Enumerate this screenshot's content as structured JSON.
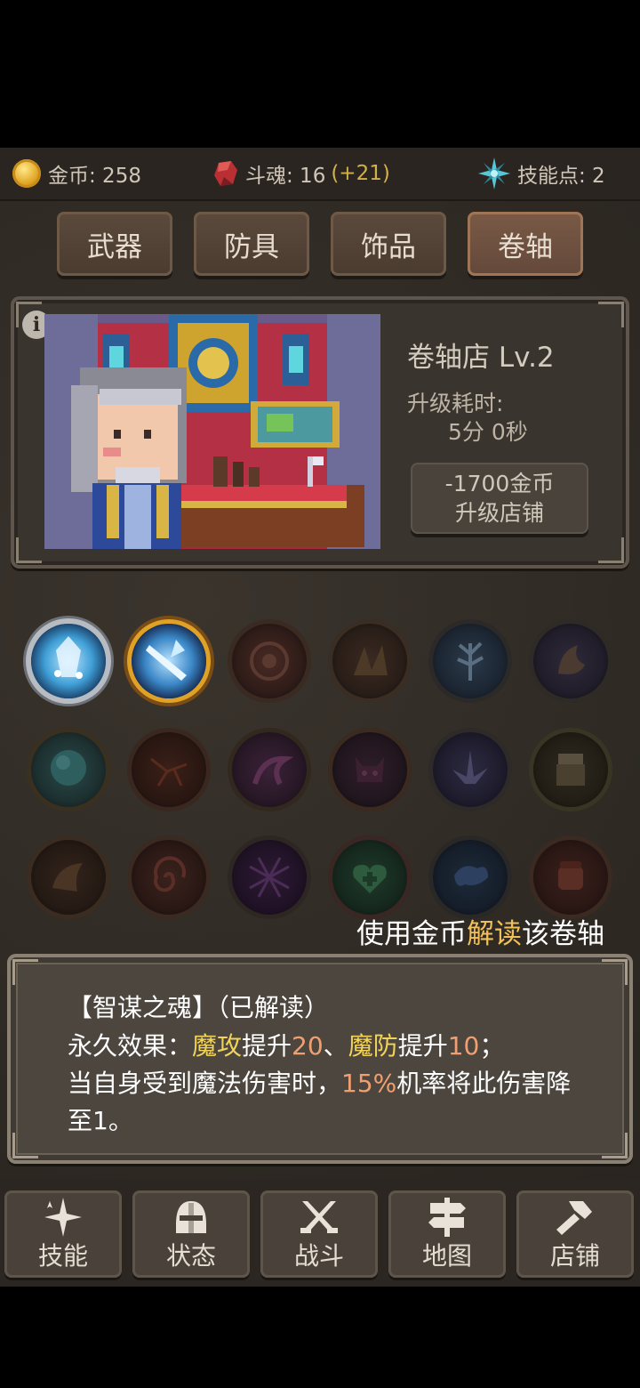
{
  "resources": {
    "gold_label": "金币: 258",
    "soul_label": "斗魂: 16",
    "soul_bonus": "(+21)",
    "skillpoint_label": "技能点: 2"
  },
  "tabs": [
    {
      "label": "武器",
      "active": false
    },
    {
      "label": "防具",
      "active": false
    },
    {
      "label": "饰品",
      "active": false
    },
    {
      "label": "卷轴",
      "active": true
    }
  ],
  "shop": {
    "info_icon": "i",
    "name": "卷轴店 Lv.2",
    "upgrade_time_label": "升级耗时:",
    "upgrade_time": "5分 0秒",
    "upgrade_cost": "-1700金币",
    "upgrade_button": "升级店铺"
  },
  "skills": [
    {
      "icon": "ice-shard-icon",
      "state": "unlocked"
    },
    {
      "icon": "lightning-strike-icon",
      "state": "selected"
    },
    {
      "icon": "target-eye-icon",
      "state": "locked"
    },
    {
      "icon": "beast-claw-icon",
      "state": "locked"
    },
    {
      "icon": "frost-tree-icon",
      "state": "locked"
    },
    {
      "icon": "dragon-fire-icon",
      "state": "locked"
    },
    {
      "icon": "water-orb-icon",
      "state": "locked"
    },
    {
      "icon": "crack-rune-icon",
      "state": "locked"
    },
    {
      "icon": "tentacle-icon",
      "state": "locked"
    },
    {
      "icon": "demon-face-icon",
      "state": "locked"
    },
    {
      "icon": "crystal-burst-icon",
      "state": "locked"
    },
    {
      "icon": "treasure-chest-icon",
      "state": "locked"
    },
    {
      "icon": "horn-icon",
      "state": "locked"
    },
    {
      "icon": "swirl-icon",
      "state": "locked"
    },
    {
      "icon": "web-net-icon",
      "state": "locked"
    },
    {
      "icon": "heart-cross-icon",
      "state": "locked"
    },
    {
      "icon": "storm-icon",
      "state": "locked"
    },
    {
      "icon": "fist-icon",
      "state": "locked"
    }
  ],
  "hint": {
    "prefix": "使用金币",
    "highlight": "解读",
    "suffix": "该卷轴"
  },
  "description": {
    "title": "【智谋之魂】（已解读）",
    "line1_a": "永久效果：",
    "line1_b": "魔攻",
    "line1_c": "提升",
    "line1_d": "20",
    "line1_e": "、",
    "line1_f": "魔防",
    "line1_g": "提升",
    "line1_h": "10",
    "line1_i": "；",
    "line2_a": "当自身受到魔法伤害时，",
    "line2_b": "15%",
    "line2_c": "机率将此伤害降",
    "line3": "至1。"
  },
  "nav": [
    {
      "label": "技能",
      "icon": "sparkle-icon"
    },
    {
      "label": "状态",
      "icon": "helmet-icon"
    },
    {
      "label": "战斗",
      "icon": "crossed-swords-icon"
    },
    {
      "label": "地图",
      "icon": "signpost-icon"
    },
    {
      "label": "店铺",
      "icon": "hammer-icon"
    }
  ],
  "colors": {
    "highlight_yellow": "#f2d35a",
    "highlight_orange": "#f0a070",
    "hint_highlight": "#f2c05a"
  }
}
